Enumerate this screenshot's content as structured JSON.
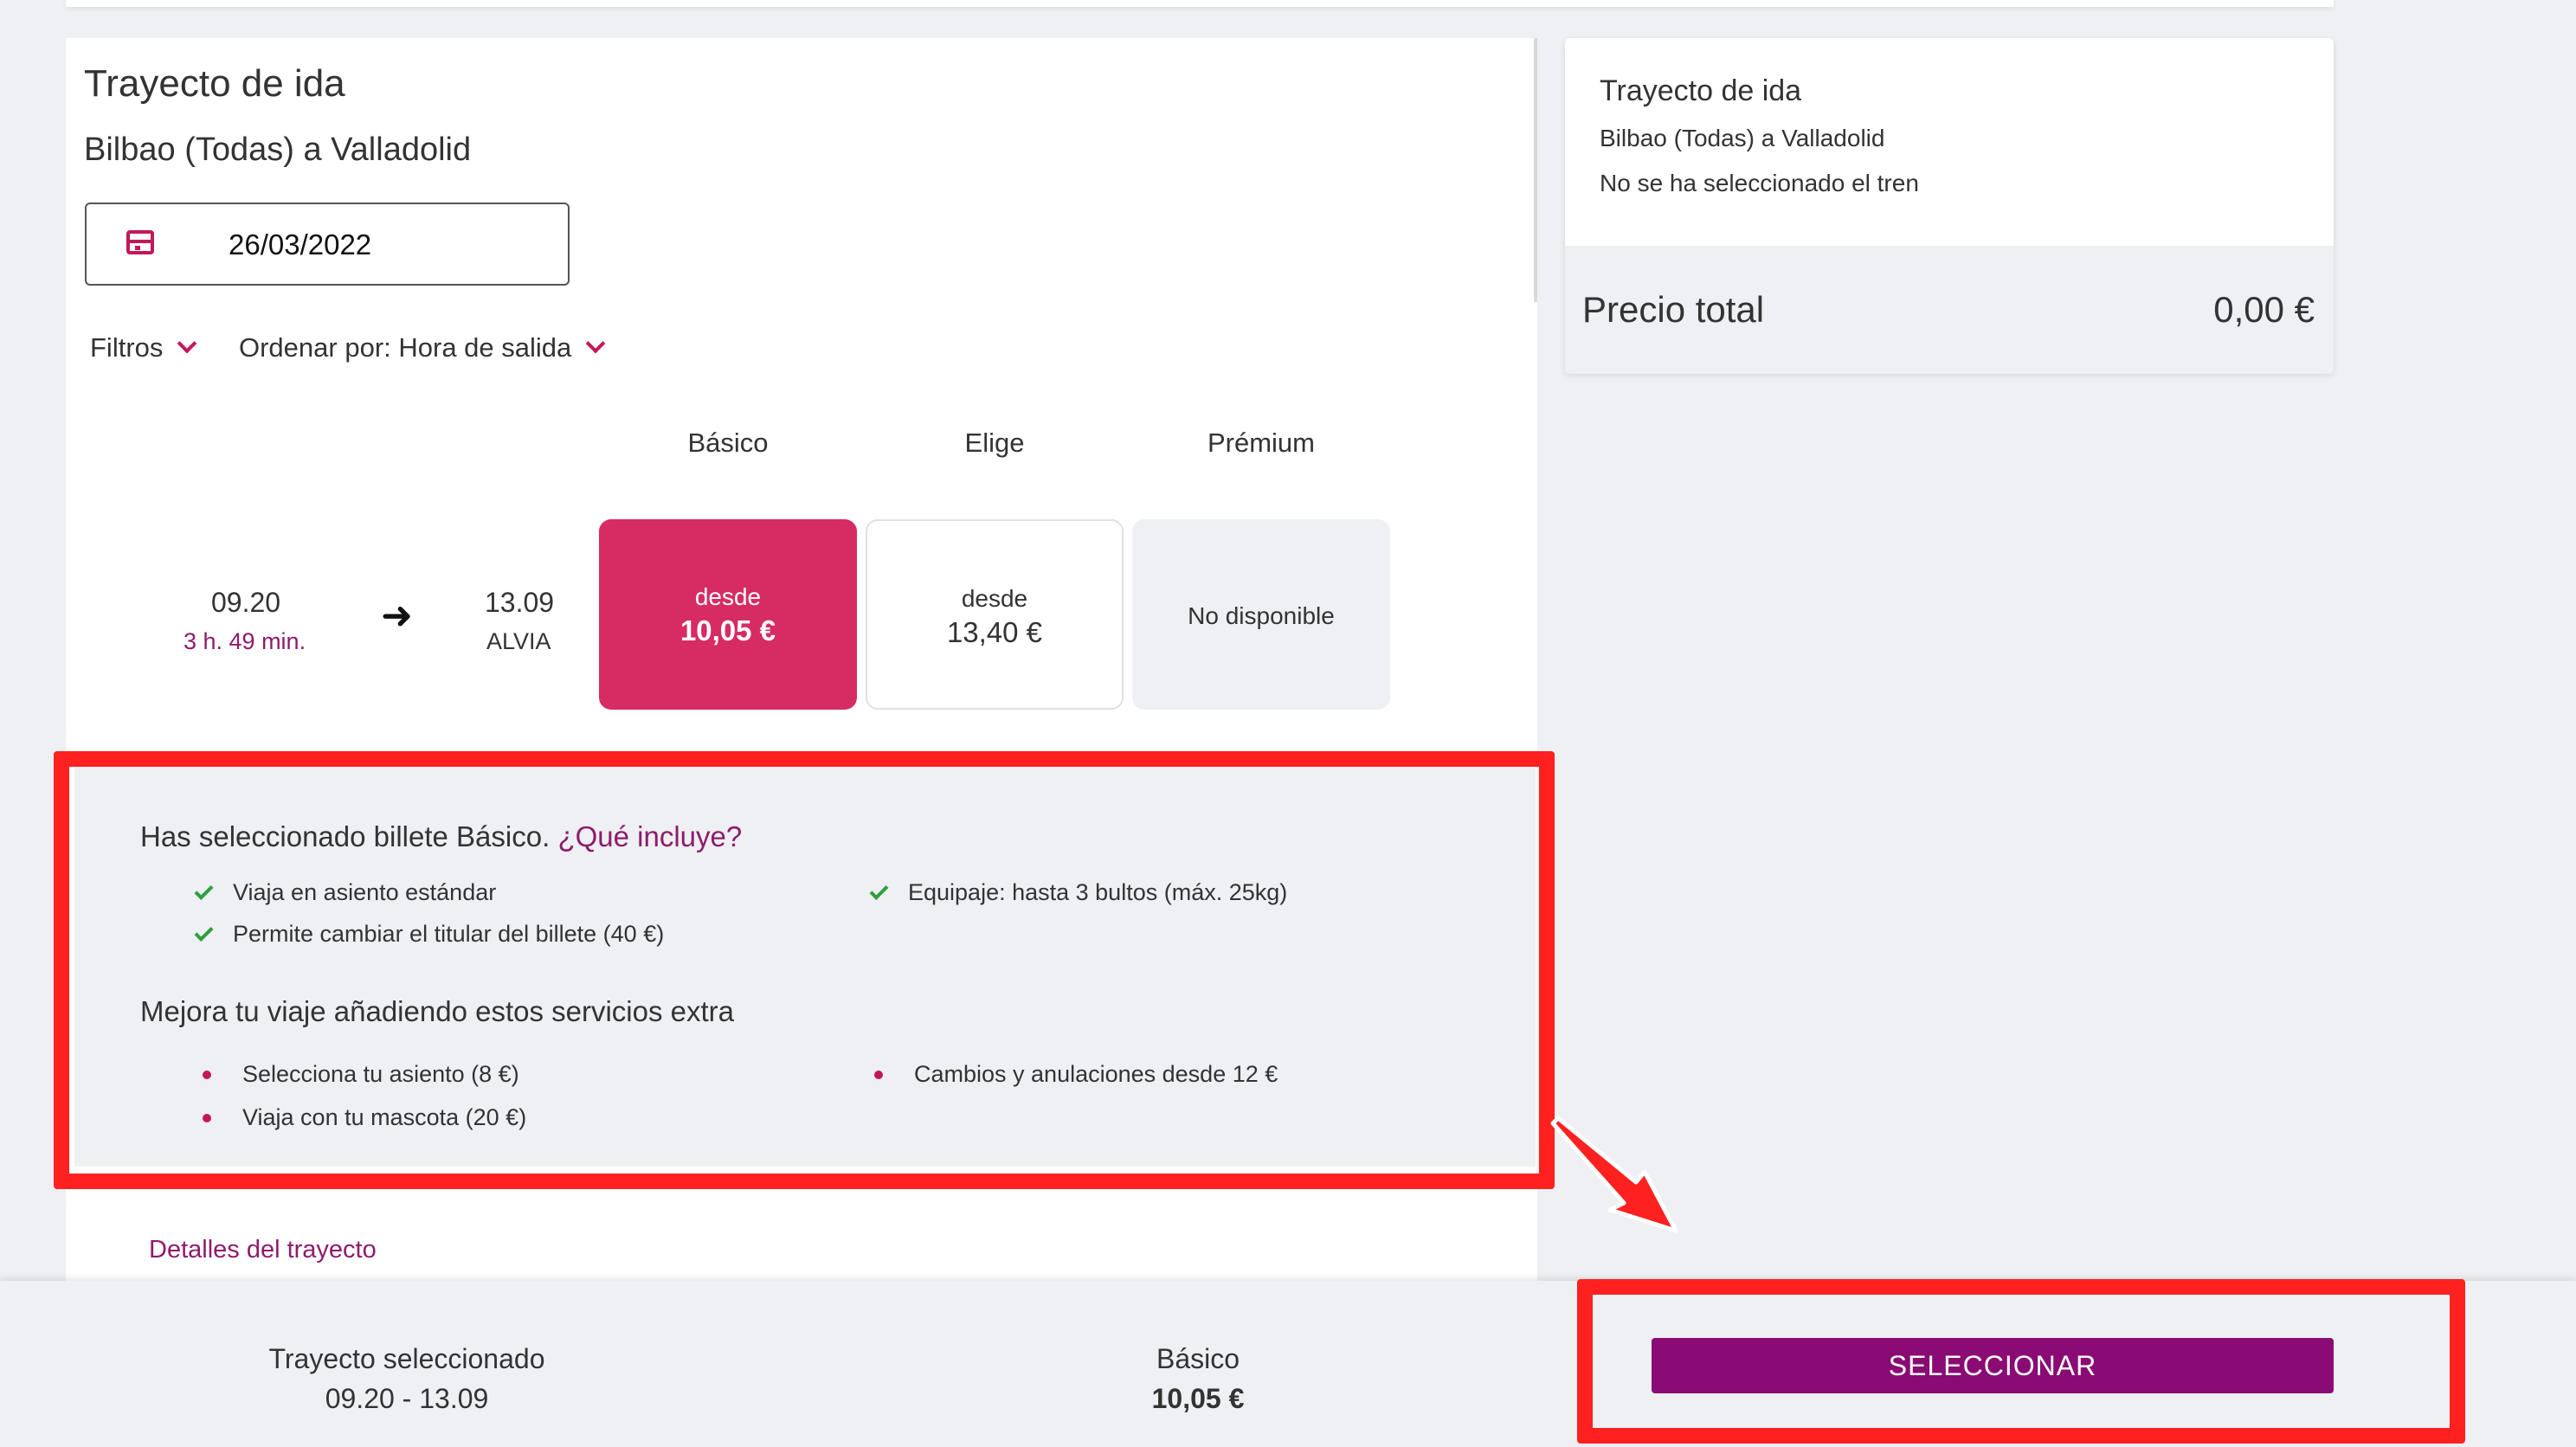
{
  "outbound": {
    "title": "Trayecto de ida",
    "route": "Bilbao (Todas) a Valladolid",
    "date": "26/03/2022",
    "filters_label": "Filtros",
    "order_label": "Ordenar por: Hora de salida"
  },
  "fare_columns": [
    "Básico",
    "Elige",
    "Prémium"
  ],
  "train": {
    "departure": "09.20",
    "duration": "3 h. 49 min.",
    "arrival": "13.09",
    "type": "ALVIA",
    "fares": [
      {
        "label": "desde",
        "price": "10,05 €",
        "selected": true
      },
      {
        "label": "desde",
        "price": "13,40 €",
        "selected": false
      },
      {
        "label": "No disponible",
        "price": "",
        "selected": false
      }
    ]
  },
  "included": {
    "title": "Has seleccionado billete Básico.",
    "link": "¿Qué incluye?",
    "items": [
      "Viaja en asiento estándar",
      "Permite cambiar el titular del billete (40 €)",
      "Equipaje: hasta 3 bultos (máx. 25kg)"
    ]
  },
  "extras": {
    "title": "Mejora tu viaje añadiendo estos servicios extra",
    "items": [
      "Selecciona tu asiento (8 €)",
      "Viaja con tu mascota (20 €)",
      "Cambios y anulaciones desde 12 €"
    ]
  },
  "details_link": "Detalles del trayecto",
  "summary": {
    "title": "Trayecto de ida",
    "route": "Bilbao (Todas) a Valladolid",
    "status": "No se ha seleccionado el tren",
    "total_label": "Precio total",
    "total_value": "0,00 €"
  },
  "bottom_bar": {
    "selected_label": "Trayecto seleccionado",
    "selected_value": "09.20 - 13.09",
    "fare_label": "Básico",
    "fare_value": "10,05 €",
    "button_label": "SELECCIONAR"
  },
  "colors": {
    "accent": "#d62b63",
    "link": "#8e1b6b",
    "button": "#8a0b74",
    "highlight": "#ff2020",
    "check": "#2e9e3e"
  }
}
